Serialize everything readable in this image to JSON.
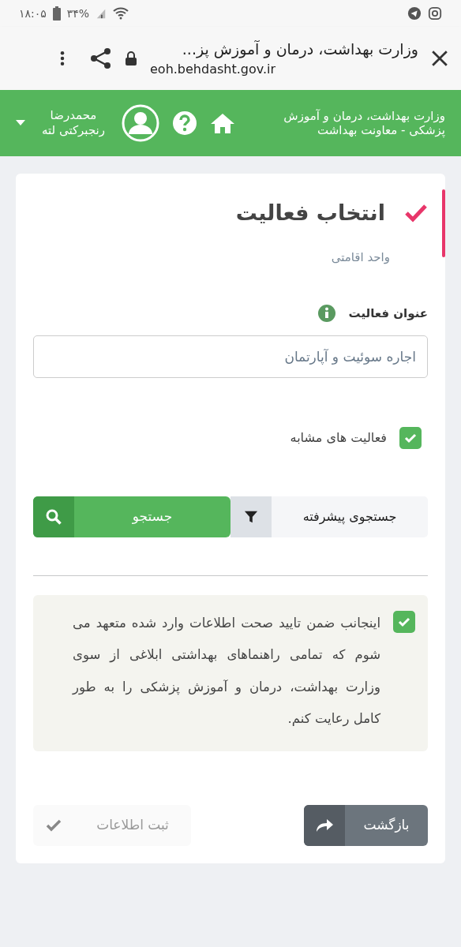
{
  "status_bar": {
    "time": "۱۸:۰۵",
    "battery": "۳۴%"
  },
  "browser": {
    "title": "وزارت بهداشت، درمان و آموزش پز...",
    "url": "eoh.behdasht.gov.ir"
  },
  "header": {
    "site_title": "وزارت بهداشت، درمان و آموزش پزشکی - معاونت بهداشت",
    "user_name": "محمدرضا رنجبرکتی لته"
  },
  "card": {
    "title": "انتخاب فعالیت",
    "subtitle": "واحد اقامتی",
    "field": {
      "label": "عنوان فعالیت",
      "value": "اجاره سوئیت و آپارتمان"
    },
    "similar": {
      "label": "فعالیت های مشابه",
      "checked": true
    },
    "search": {
      "advanced_label": "جستجوی پیشرفته",
      "button": "جستجو"
    },
    "agreement": {
      "text": "اینجانب ضمن تایید صحت اطلاعات وارد شده متعهد می شوم که تمامی راهنماهای بهداشتی ابلاغی از سوی وزارت بهداشت، درمان و آموزش پزشکی را به طور کامل رعایت کنم.",
      "checked": true
    },
    "buttons": [
      {
        "label": "بازگشت",
        "kind": "back",
        "disabled": false
      },
      {
        "label": "ثبت اطلاعات",
        "kind": "submit",
        "disabled": true
      }
    ]
  }
}
